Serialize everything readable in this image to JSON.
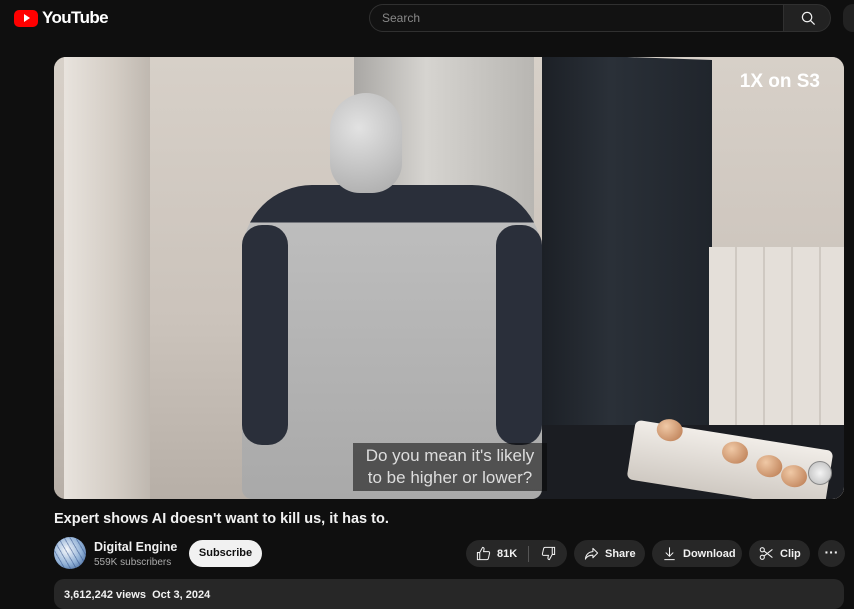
{
  "header": {
    "logo_text": "YouTube",
    "search_placeholder": "Search"
  },
  "video": {
    "overlay": "1X on S3",
    "captions": [
      "Do you mean it's likely",
      "to be higher or lower?"
    ],
    "title": "Expert shows AI doesn't want to kill us, it has to."
  },
  "channel": {
    "name": "Digital Engine",
    "subscribers": "559K subscribers",
    "subscribe_label": "Subscribe"
  },
  "actions": {
    "likes": "81K",
    "share_label": "Share",
    "download_label": "Download",
    "clip_label": "Clip",
    "more_label": "···"
  },
  "description": {
    "views": "3,612,242 views",
    "date": "Oct 3, 2024"
  },
  "colors": {
    "background": "#0f0f0f",
    "brand_red": "#ff0000",
    "pill": "#272727"
  }
}
